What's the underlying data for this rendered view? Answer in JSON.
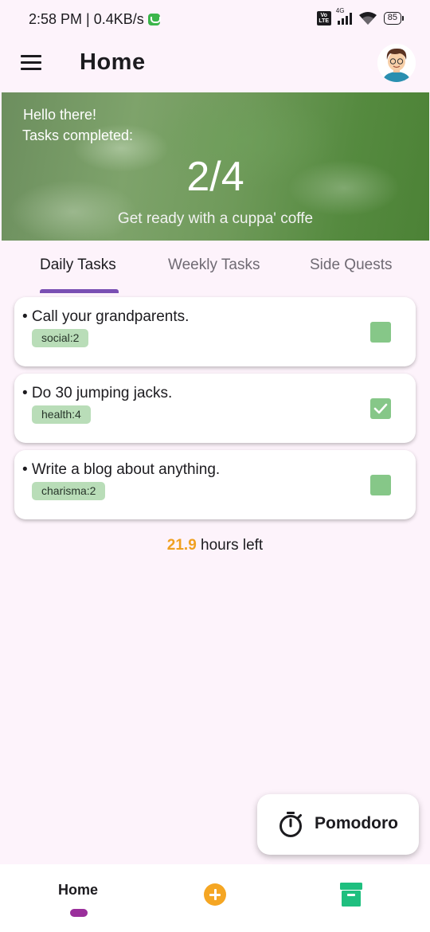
{
  "status_bar": {
    "time_speed": "2:58 PM | 0.4KB/s",
    "network": "4G",
    "volte": "Vo LTE",
    "battery": "85"
  },
  "app_bar": {
    "title": "Home"
  },
  "hero": {
    "greeting": "Hello there!",
    "subtitle": "Tasks completed:",
    "count": "2/4",
    "quote": "Get ready with a cuppa' coffe"
  },
  "tabs": [
    {
      "label": "Daily Tasks",
      "active": true
    },
    {
      "label": "Weekly Tasks",
      "active": false
    },
    {
      "label": "Side Quests",
      "active": false
    }
  ],
  "tasks": [
    {
      "title": "• Call your grandparents.",
      "tag": "social:2",
      "checked": false
    },
    {
      "title": "• Do 30 jumping jacks.",
      "tag": "health:4",
      "checked": true
    },
    {
      "title": "• Write a blog about anything.",
      "tag": "charisma:2",
      "checked": false
    }
  ],
  "hours_left": {
    "value": "21.9",
    "suffix": " hours left"
  },
  "fab": {
    "label": "Pomodoro",
    "icon": "timer-icon"
  },
  "bottom_nav": {
    "home_label": "Home",
    "add_icon": "add-circle-icon",
    "archive_icon": "archive-icon"
  },
  "colors": {
    "background": "#fdf3fb",
    "accent_tab": "#7a4fb3",
    "check": "#86c788",
    "tag": "#b9ddb8",
    "hours": "#f0a020",
    "nav_indicator": "#9a2f9b",
    "add": "#f5a623",
    "archive": "#1fbf7f"
  }
}
